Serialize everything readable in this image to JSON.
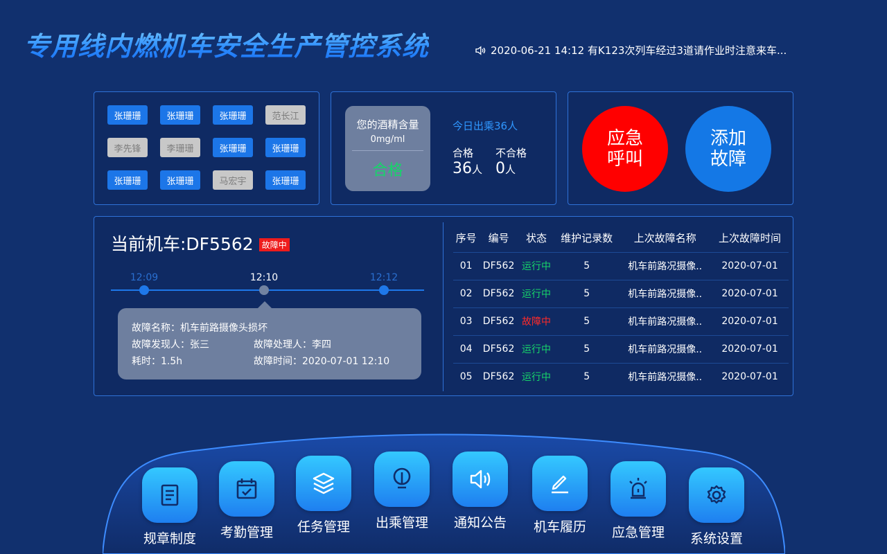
{
  "header": {
    "title": "专用线内燃机车安全生产管控系统",
    "notice": "2020-06-21 14:12 有K123次列车经过3道请作业时注意来车..."
  },
  "staff": [
    {
      "name": "张珊珊",
      "active": true
    },
    {
      "name": "张珊珊",
      "active": true
    },
    {
      "name": "张珊珊",
      "active": true
    },
    {
      "name": "范长江",
      "active": false
    },
    {
      "name": "李先锋",
      "active": false
    },
    {
      "name": "李珊珊",
      "active": false
    },
    {
      "name": "张珊珊",
      "active": true
    },
    {
      "name": "张珊珊",
      "active": true
    },
    {
      "name": "张珊珊",
      "active": true
    },
    {
      "name": "张珊珊",
      "active": true
    },
    {
      "name": "马宏宇",
      "active": false
    },
    {
      "name": "张珊珊",
      "active": true
    }
  ],
  "alcohol": {
    "title": "您的酒精含量",
    "unit": "0mg/ml",
    "result": "合格",
    "today": "今日出乘36人",
    "pass_label": "合格",
    "pass_value": "36",
    "fail_label": "不合格",
    "fail_value": "0",
    "person_unit": "人"
  },
  "actions": {
    "emergency_line1": "应急",
    "emergency_line2": "呼叫",
    "fault_line1": "添加",
    "fault_line2": "故障"
  },
  "loco": {
    "title": "当前机车:DF5562",
    "badge": "故障中",
    "timeline": [
      "12:09",
      "12:10",
      "12:12"
    ],
    "timeline_active": 1,
    "detail": {
      "name": "故障名称：机车前路摄像头损坏",
      "finder": "故障发现人：张三",
      "handler": "故障处理人：李四",
      "duration": "耗时：1.5h",
      "time": "故障时间：2020-07-01 12:10"
    }
  },
  "table": {
    "headers": [
      "序号",
      "编号",
      "状态",
      "维护记录数",
      "上次故障名称",
      "上次故障时间"
    ],
    "rows": [
      [
        "01",
        "DF562",
        "运行中",
        "5",
        "机车前路况摄像..",
        "2020-07-01"
      ],
      [
        "02",
        "DF562",
        "运行中",
        "5",
        "机车前路况摄像..",
        "2020-07-01"
      ],
      [
        "03",
        "DF562",
        "故障中",
        "5",
        "机车前路况摄像..",
        "2020-07-01"
      ],
      [
        "04",
        "DF562",
        "运行中",
        "5",
        "机车前路况摄像..",
        "2020-07-01"
      ],
      [
        "05",
        "DF562",
        "运行中",
        "5",
        "机车前路况摄像..",
        "2020-07-01"
      ]
    ]
  },
  "dock": [
    {
      "label": "规章制度",
      "icon": "document-icon"
    },
    {
      "label": "考勤管理",
      "icon": "calendar-check-icon"
    },
    {
      "label": "任务管理",
      "icon": "layers-icon"
    },
    {
      "label": "出乘管理",
      "icon": "signal-post-icon"
    },
    {
      "label": "通知公告",
      "icon": "speaker-icon"
    },
    {
      "label": "机车履历",
      "icon": "pencil-icon"
    },
    {
      "label": "应急管理",
      "icon": "alarm-light-icon"
    },
    {
      "label": "系统设置",
      "icon": "gear-icon"
    }
  ]
}
